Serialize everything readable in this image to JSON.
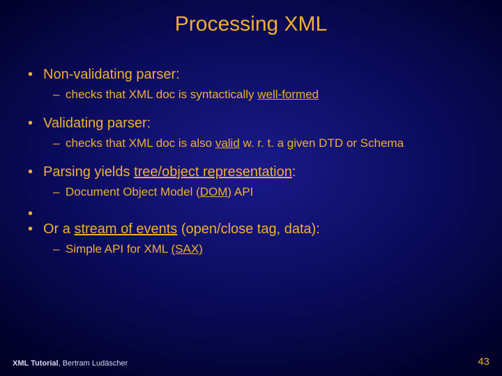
{
  "title": "Processing XML",
  "bullets": {
    "b1": {
      "pre": "Non-validating parser",
      "post": ":"
    },
    "b1s": {
      "pre": "checks that XML doc is syntactically ",
      "u": "well-formed",
      "post": ""
    },
    "b2": {
      "pre": "Validating parser",
      "post": ":"
    },
    "b2s": {
      "pre": "checks that XML doc is also ",
      "u": "valid",
      "post": " w. r. t. a given DTD or Schema"
    },
    "b3": {
      "pre": "Parsing yields ",
      "u": "tree/object representation",
      "post": ":"
    },
    "b3s": {
      "pre": "Document Object Model (",
      "u": "DOM",
      "post": ") API"
    },
    "b4": {
      "pre": "Or a ",
      "u": "stream of events",
      "post": " (open/close tag, data):"
    },
    "b4s": {
      "pre": "Simple API for XML ",
      "u": "(SAX)",
      "post": ""
    }
  },
  "footer": {
    "left_bold": "XML Tutorial",
    "left_rest": ", Bertram Ludäscher",
    "page": "43"
  }
}
